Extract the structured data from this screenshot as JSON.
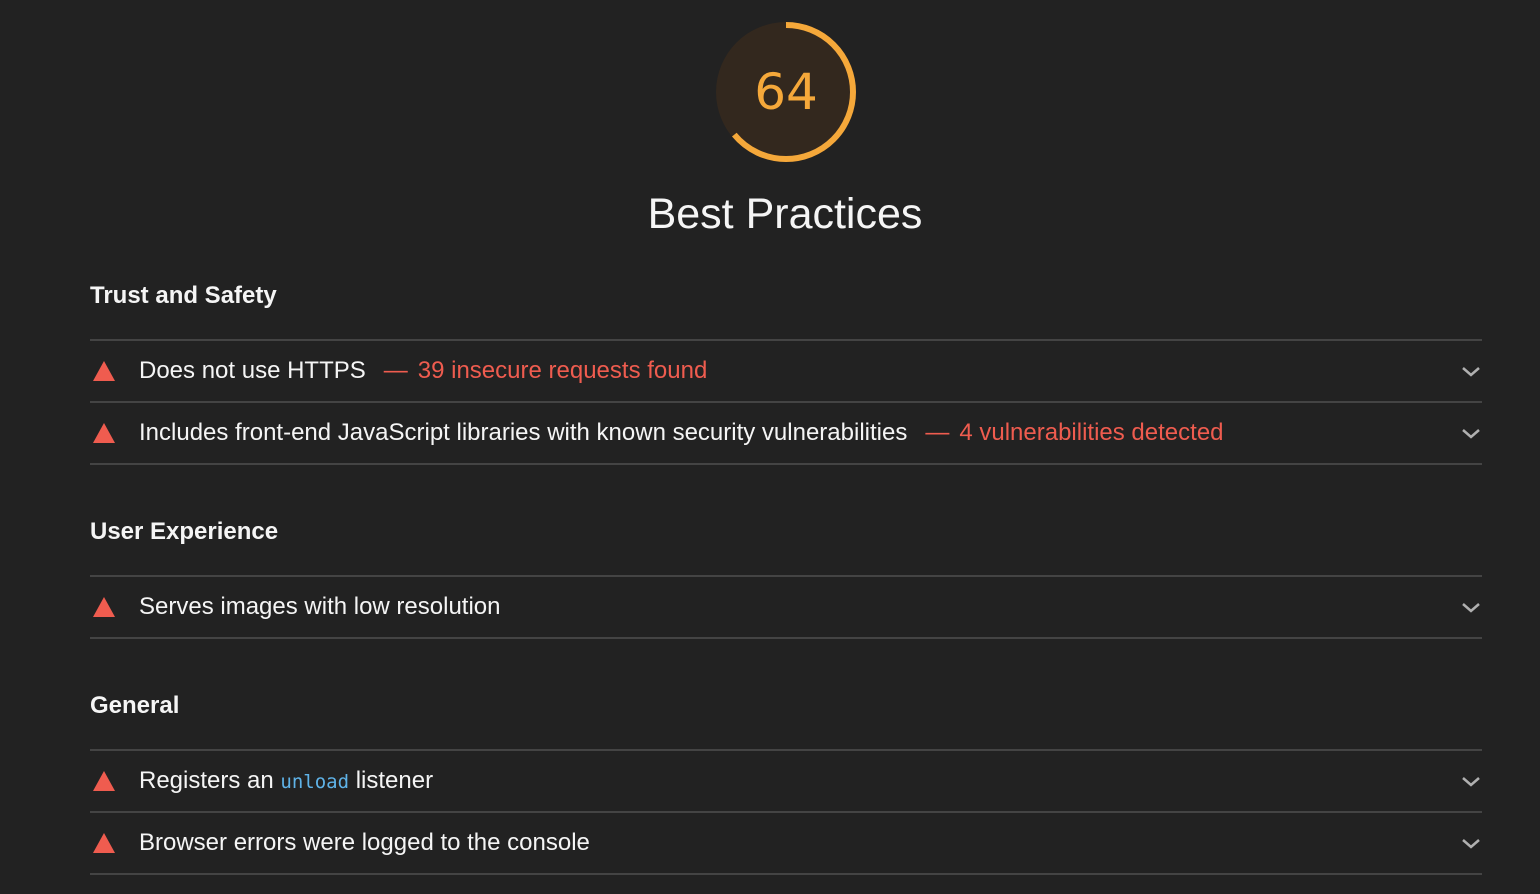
{
  "category": {
    "score": "64",
    "score_fraction": 0.64,
    "title": "Best Practices",
    "score_color": "#f5a83a"
  },
  "groups": [
    {
      "title": "Trust and Safety",
      "audits": [
        {
          "title": "Does not use HTTPS",
          "dash": "—",
          "detail": "39 insecure requests found",
          "icon": "fail-triangle-icon"
        },
        {
          "title": "Includes front-end JavaScript libraries with known security vulnerabilities",
          "dash": "—",
          "detail": "4 vulnerabilities detected",
          "icon": "fail-triangle-icon"
        }
      ]
    },
    {
      "title": "User Experience",
      "audits": [
        {
          "title": "Serves images with low resolution",
          "icon": "fail-triangle-icon"
        }
      ]
    },
    {
      "title": "General",
      "audits": [
        {
          "title_before": "Registers an",
          "title_code": "unload",
          "title_after": "listener",
          "icon": "fail-triangle-icon"
        },
        {
          "title": "Browser errors were logged to the console",
          "icon": "fail-triangle-icon"
        }
      ]
    }
  ],
  "colors": {
    "background": "#222222",
    "fail": "#ef5c4f",
    "average": "#f5a83a",
    "code": "#5fb3e8",
    "divider": "#444444"
  }
}
